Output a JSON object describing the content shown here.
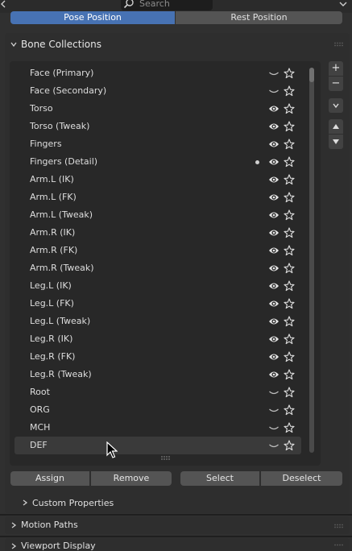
{
  "header": {
    "search_placeholder": "Search",
    "pose_label": "Pose Position",
    "rest_label": "Rest Position"
  },
  "panel": {
    "title": "Bone Collections"
  },
  "collections": [
    {
      "label": "Face (Primary)",
      "visible": false,
      "dot": false
    },
    {
      "label": "Face (Secondary)",
      "visible": false,
      "dot": false
    },
    {
      "label": "Torso",
      "visible": true,
      "dot": false
    },
    {
      "label": "Torso (Tweak)",
      "visible": true,
      "dot": false
    },
    {
      "label": "Fingers",
      "visible": true,
      "dot": false
    },
    {
      "label": "Fingers (Detail)",
      "visible": true,
      "dot": true
    },
    {
      "label": "Arm.L (IK)",
      "visible": true,
      "dot": false
    },
    {
      "label": "Arm.L (FK)",
      "visible": true,
      "dot": false
    },
    {
      "label": "Arm.L (Tweak)",
      "visible": true,
      "dot": false
    },
    {
      "label": "Arm.R (IK)",
      "visible": true,
      "dot": false
    },
    {
      "label": "Arm.R (FK)",
      "visible": true,
      "dot": false
    },
    {
      "label": "Arm.R (Tweak)",
      "visible": true,
      "dot": false
    },
    {
      "label": "Leg.L (IK)",
      "visible": true,
      "dot": false
    },
    {
      "label": "Leg.L (FK)",
      "visible": true,
      "dot": false
    },
    {
      "label": "Leg.L (Tweak)",
      "visible": true,
      "dot": false
    },
    {
      "label": "Leg.R (IK)",
      "visible": true,
      "dot": false
    },
    {
      "label": "Leg.R (FK)",
      "visible": true,
      "dot": false
    },
    {
      "label": "Leg.R (Tweak)",
      "visible": true,
      "dot": false
    },
    {
      "label": "Root",
      "visible": false,
      "dot": false
    },
    {
      "label": "ORG",
      "visible": false,
      "dot": false
    },
    {
      "label": "MCH",
      "visible": false,
      "dot": false
    },
    {
      "label": "DEF",
      "visible": false,
      "dot": false
    }
  ],
  "side_buttons": {
    "add": "+",
    "remove": "−"
  },
  "actions": {
    "assign": "Assign",
    "remove": "Remove",
    "select": "Select",
    "deselect": "Deselect"
  },
  "subpanels": {
    "custom_properties": "Custom Properties",
    "motion_paths": "Motion Paths",
    "viewport_display": "Viewport Display"
  },
  "colors": {
    "accent": "#4772b3",
    "panel": "#2e2e2e",
    "list": "#282828"
  }
}
